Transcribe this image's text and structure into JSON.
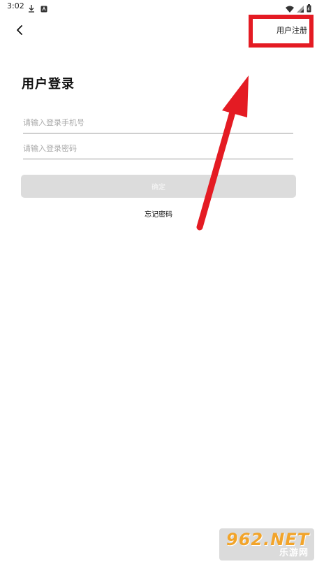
{
  "status_bar": {
    "time": "3:02",
    "icons": [
      "download-icon",
      "app-notification-icon",
      "wifi-icon",
      "signal-icon",
      "battery-icon"
    ]
  },
  "header": {
    "back_icon": "chevron-left-icon",
    "register_label": "用户注册"
  },
  "login": {
    "title": "用户登录",
    "phone_placeholder": "请输入登录手机号",
    "password_placeholder": "请输入登录密码",
    "confirm_label": "确定",
    "forgot_label": "忘记密码"
  },
  "watermark": {
    "brand": "962.NET",
    "sub": "乐游网"
  },
  "colors": {
    "annotation": "#e41b23",
    "button_bg": "#dcdcdc",
    "brand": "#f2a42a"
  }
}
